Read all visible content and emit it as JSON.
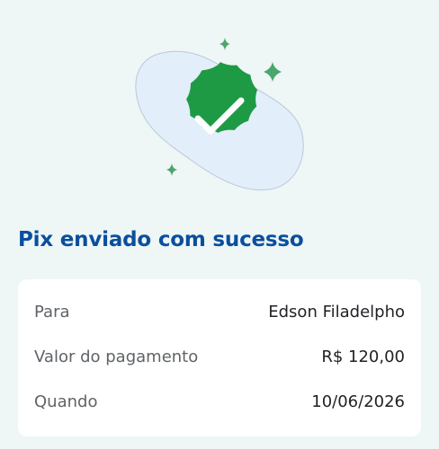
{
  "receipt": {
    "title": "Pix enviado com sucesso",
    "rows": [
      {
        "label": "Para",
        "value": "Edson Filadelpho"
      },
      {
        "label": "Valor do pagamento",
        "value": "R$ 120,00"
      },
      {
        "label": "Quando",
        "value": "10/06/2026"
      }
    ]
  },
  "icons": {
    "success": "check-badge-icon",
    "decorations": [
      "sparkle-icon",
      "sparkle-icon",
      "sparkle-icon"
    ]
  },
  "colors": {
    "background": "#eef6f6",
    "title": "#0a4f9e",
    "badge": "#1f9a44",
    "blob": "#e3eefb",
    "blob_stroke": "#b8c8dc",
    "sparkle": "#4aa66c",
    "label": "#5f6367",
    "value": "#1f2124"
  }
}
